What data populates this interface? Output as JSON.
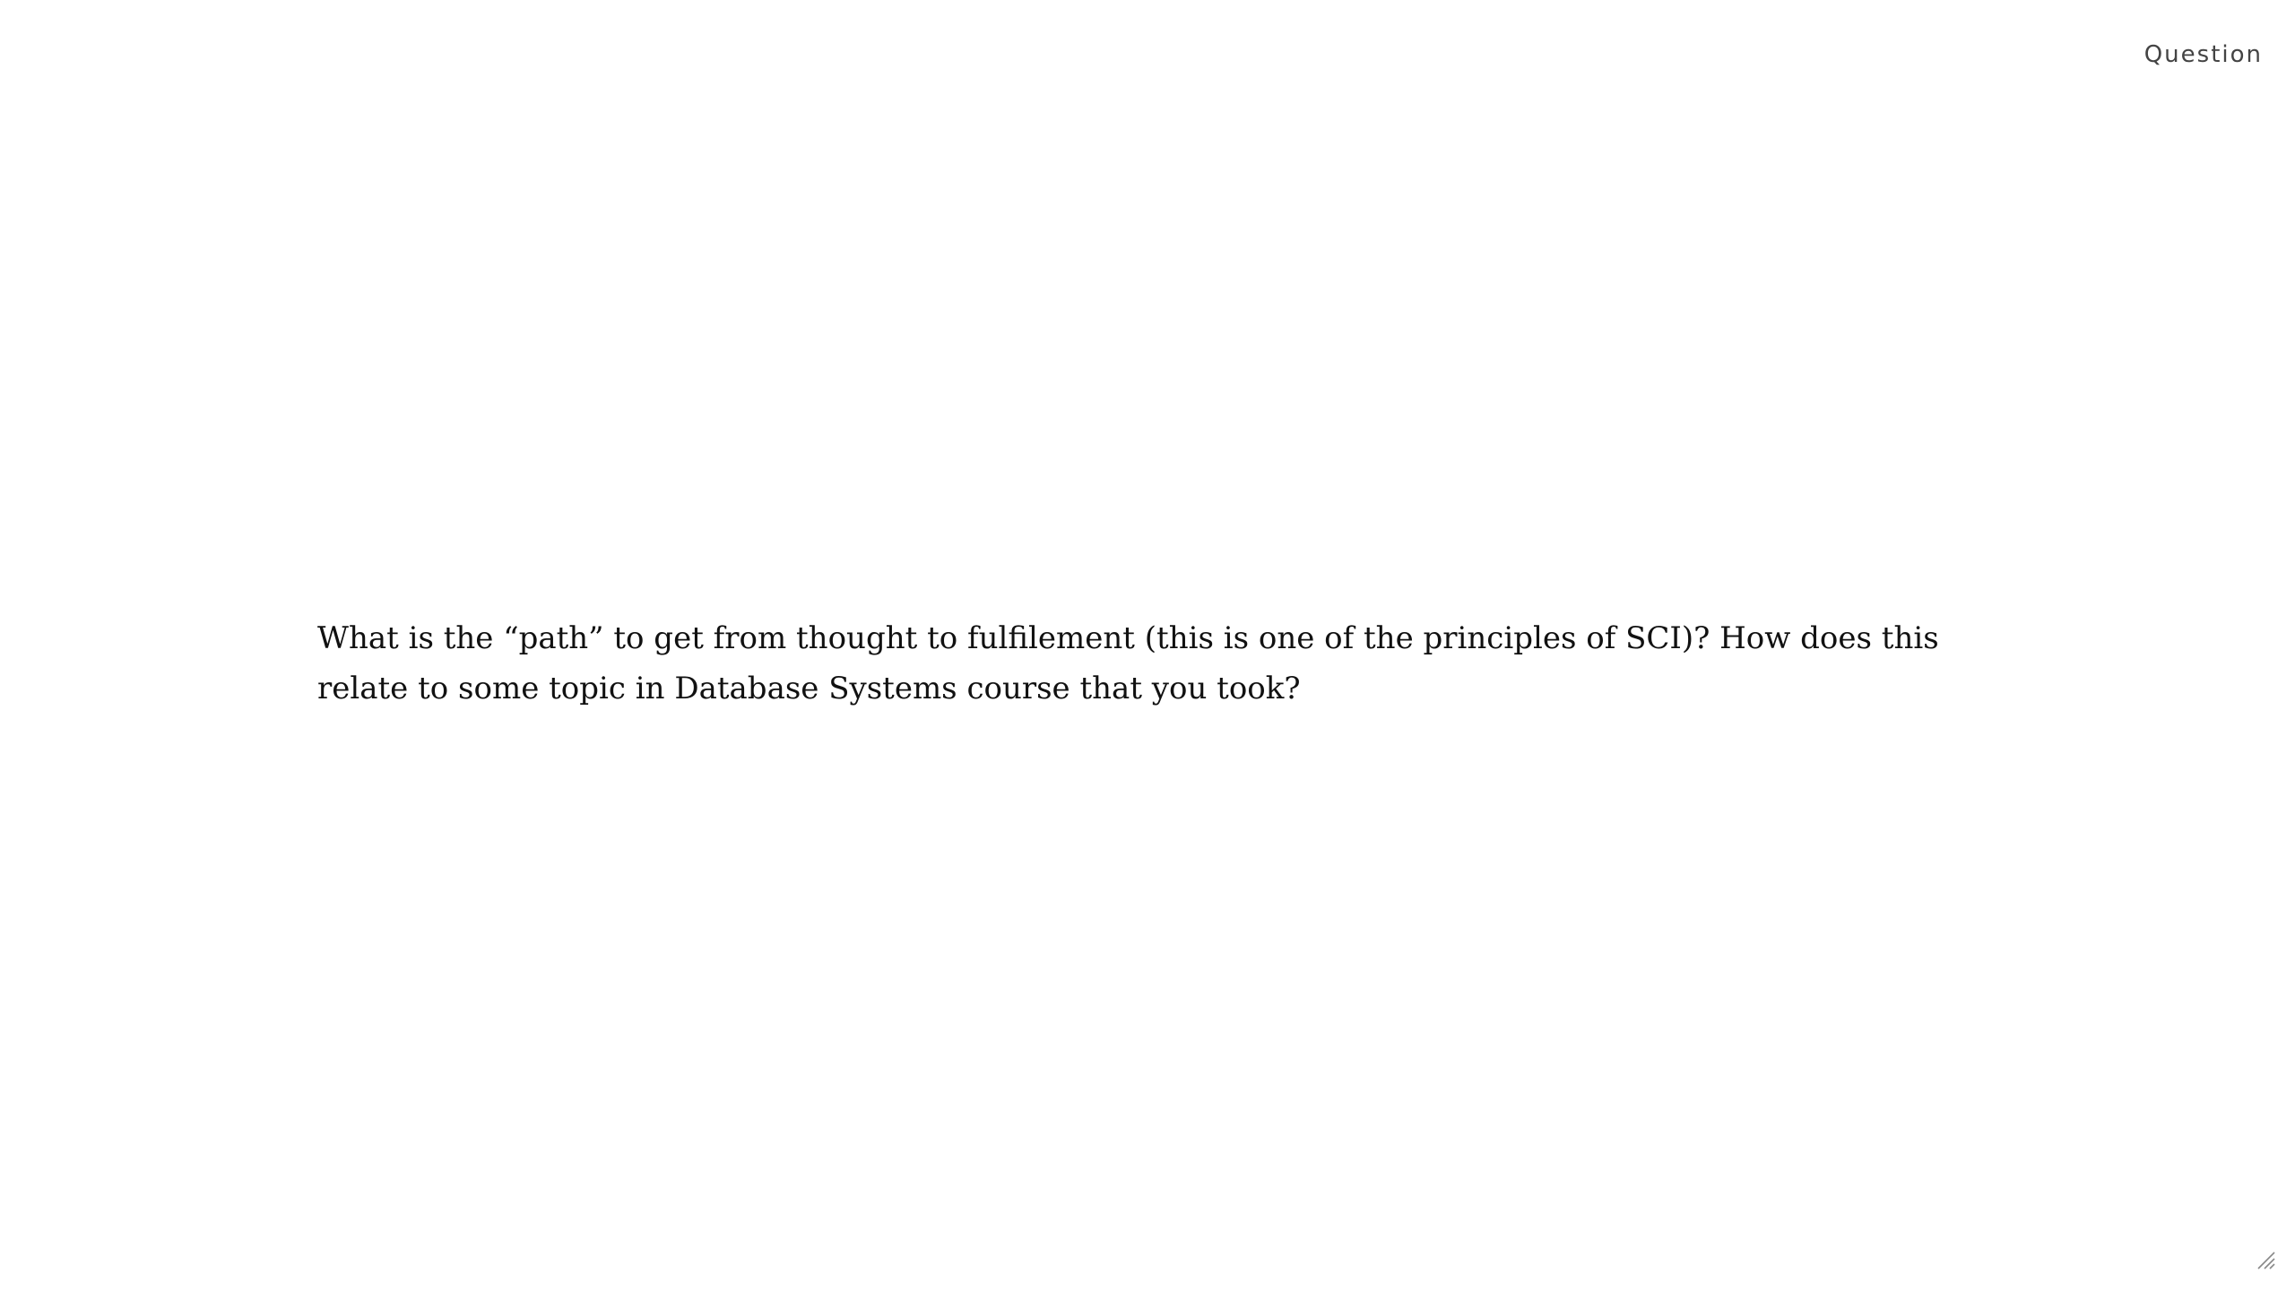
{
  "slide": {
    "label": "Question",
    "question": "What is the “path” to get from thought to fulfilement (this is one of the principles of SCI)? How does this relate to some topic in Database Systems course that you took?"
  },
  "icons": {
    "resize": "resize-grip-icon"
  },
  "colors": {
    "background": "#ffffff",
    "text": "#111111",
    "label": "#444444"
  }
}
